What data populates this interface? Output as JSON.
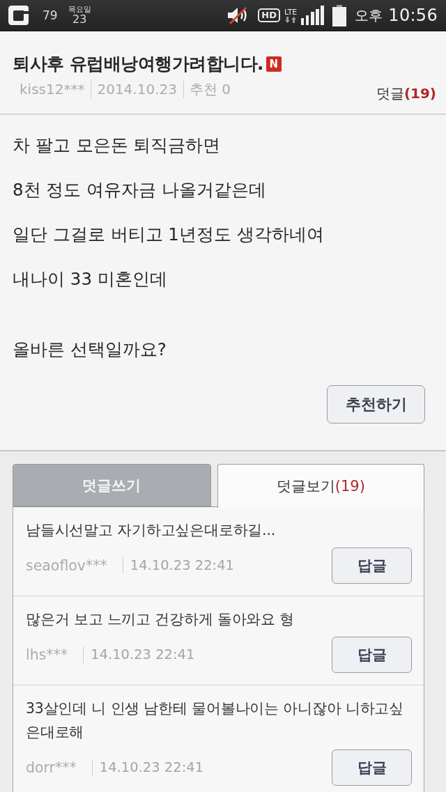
{
  "status_bar": {
    "notification_count": "79",
    "weekday": "목요일",
    "day": "23",
    "muted": true,
    "hd_label": "HD",
    "network_label": "LTE",
    "ampm": "오후",
    "time": "10:56"
  },
  "post": {
    "title": "퇴사후 유럽배낭여행가려합니다.",
    "new_badge": "N",
    "author": "kiss12***",
    "date": "2014.10.23",
    "recommend_count": "추천 0",
    "comments_label": "덧글",
    "comments_count": "(19)",
    "paragraphs": [
      {
        "lines": [
          "차 팔고 모은돈 퇴직금하면",
          "8천 정도 여유자금 나올거같은데",
          "일단 그걸로 버티고 1년정도 생각하네여",
          "내나이 33 미혼인데"
        ]
      },
      {
        "lines": [
          "올바른 선택일까요?"
        ]
      }
    ],
    "recommend_button": "추천하기"
  },
  "tabs": [
    {
      "label": "덧글쓰기",
      "selected": false
    },
    {
      "label": "덧글보기",
      "count": "(19)",
      "selected": true
    }
  ],
  "comments": [
    {
      "text": "남들시선말고 자기하고싶은대로하길...",
      "author": "seaoflov***",
      "time": "14.10.23 22:41",
      "reply_button": "답글"
    },
    {
      "text": "많은거 보고 느끼고 건강하게 돌아와요 형",
      "author": "lhs***",
      "time": "14.10.23 22:41",
      "reply_button": "답글"
    },
    {
      "text": "33살인데 니 인생 남한테 물어볼나이는 아니잖아 니하고싶은대로해",
      "author": "dorr***",
      "time": "14.10.23 22:41",
      "reply_button": "답글"
    }
  ]
}
